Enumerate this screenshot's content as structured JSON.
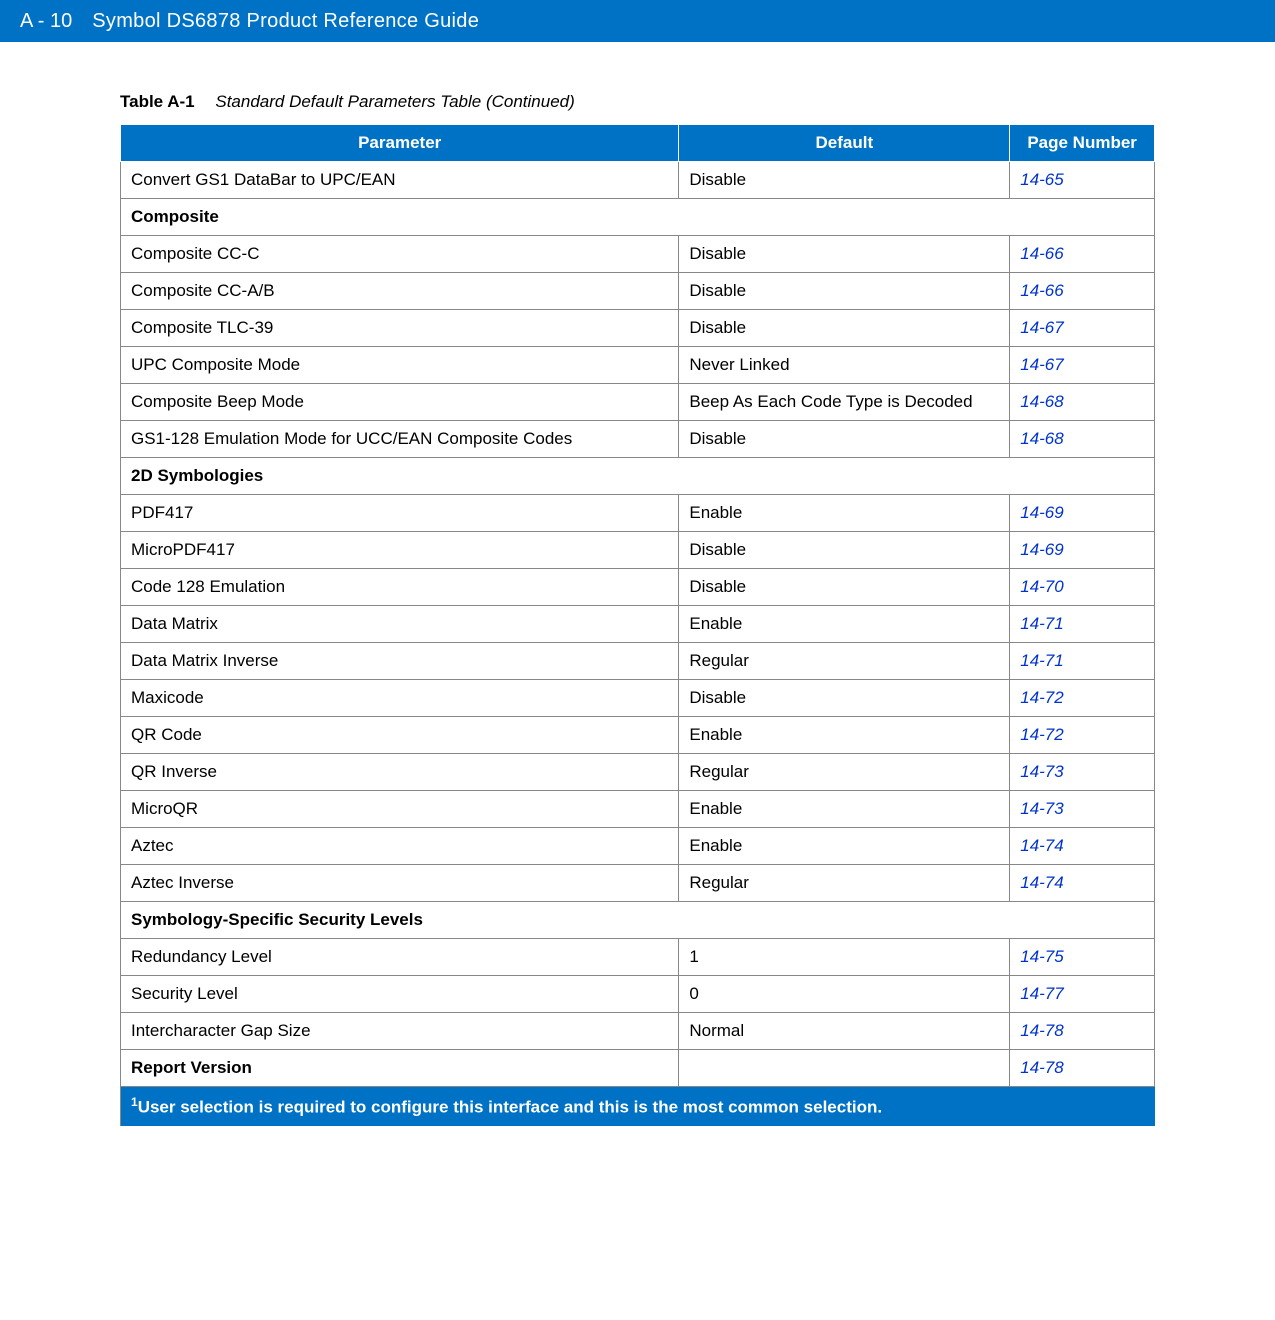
{
  "header": {
    "page_id": "A - 10",
    "title": "Symbol DS6878 Product Reference Guide"
  },
  "table_caption": {
    "number": "Table A-1",
    "title": "Standard Default Parameters Table (Continued)"
  },
  "columns": {
    "c0": "Parameter",
    "c1": "Default",
    "c2": "Page Number"
  },
  "rows": [
    {
      "type": "data",
      "parameter": "Convert GS1 DataBar to UPC/EAN",
      "default": "Disable",
      "page": "14-65"
    },
    {
      "type": "section",
      "parameter": "Composite"
    },
    {
      "type": "data",
      "parameter": "Composite CC-C",
      "default": "Disable",
      "page": "14-66"
    },
    {
      "type": "data",
      "parameter": "Composite CC-A/B",
      "default": "Disable",
      "page": "14-66"
    },
    {
      "type": "data",
      "parameter": "Composite TLC-39",
      "default": "Disable",
      "page": "14-67"
    },
    {
      "type": "data",
      "parameter": "UPC Composite Mode",
      "default": "Never Linked",
      "page": "14-67"
    },
    {
      "type": "data",
      "parameter": "Composite Beep Mode",
      "default": "Beep As Each Code Type is Decoded",
      "page": "14-68"
    },
    {
      "type": "data",
      "parameter": "GS1-128 Emulation Mode for UCC/EAN Composite Codes",
      "default": "Disable",
      "page": "14-68"
    },
    {
      "type": "section",
      "parameter": "2D Symbologies"
    },
    {
      "type": "data",
      "parameter": "PDF417",
      "default": "Enable",
      "page": "14-69"
    },
    {
      "type": "data",
      "parameter": "MicroPDF417",
      "default": "Disable",
      "page": "14-69"
    },
    {
      "type": "data",
      "parameter": "Code 128 Emulation",
      "default": "Disable",
      "page": "14-70"
    },
    {
      "type": "data",
      "parameter": "Data Matrix",
      "default": "Enable",
      "page": "14-71"
    },
    {
      "type": "data",
      "parameter": "Data Matrix Inverse",
      "default": "Regular",
      "page": "14-71"
    },
    {
      "type": "data",
      "parameter": "Maxicode",
      "default": "Disable",
      "page": "14-72"
    },
    {
      "type": "data",
      "parameter": "QR Code",
      "default": "Enable",
      "page": "14-72"
    },
    {
      "type": "data",
      "parameter": "QR Inverse",
      "default": "Regular",
      "page": "14-73"
    },
    {
      "type": "data",
      "parameter": "MicroQR",
      "default": "Enable",
      "page": "14-73"
    },
    {
      "type": "data",
      "parameter": "Aztec",
      "default": "Enable",
      "page": "14-74"
    },
    {
      "type": "data",
      "parameter": "Aztec Inverse",
      "default": "Regular",
      "page": "14-74"
    },
    {
      "type": "section",
      "parameter": "Symbology-Specific Security Levels"
    },
    {
      "type": "data",
      "parameter": "Redundancy Level",
      "default": "1",
      "page": "14-75"
    },
    {
      "type": "data",
      "parameter": "Security Level",
      "default": "0",
      "page": "14-77"
    },
    {
      "type": "data",
      "parameter": "Intercharacter Gap Size",
      "default": "Normal",
      "page": "14-78"
    },
    {
      "type": "data",
      "parameter": "Report Version",
      "default": "",
      "page": "14-78",
      "bold_param": true
    }
  ],
  "footnote": {
    "sup": "1",
    "text": "User selection is required to configure this interface and this is the most common selection."
  }
}
